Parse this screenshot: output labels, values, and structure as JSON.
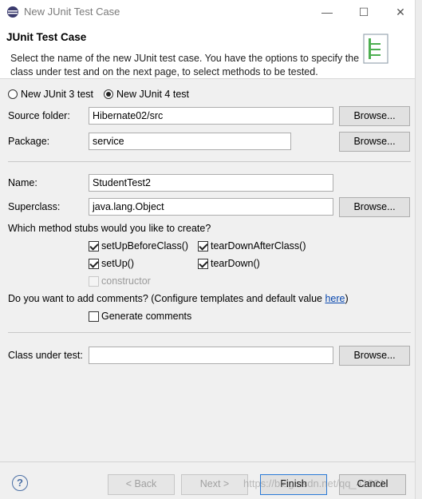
{
  "window": {
    "title": "New JUnit Test Case",
    "minimize_glyph": "—",
    "maximize_glyph": "☐",
    "close_glyph": "✕"
  },
  "banner": {
    "title": "JUnit Test Case",
    "description": "Select the name of the new JUnit test case. You have the options to specify the class under test and on the next page, to select methods to be tested."
  },
  "version": {
    "junit3_label": "New JUnit 3 test",
    "junit4_label": "New JUnit 4 test",
    "selected": "junit4"
  },
  "source_folder": {
    "label": "Source folder:",
    "value": "Hibernate02/src",
    "browse": "Browse..."
  },
  "package": {
    "label": "Package:",
    "value": "service",
    "browse": "Browse..."
  },
  "name": {
    "label": "Name:",
    "value": "StudentTest2"
  },
  "superclass": {
    "label": "Superclass:",
    "value": "java.lang.Object",
    "browse": "Browse..."
  },
  "stubs": {
    "question": "Which method stubs would you like to create?",
    "items": [
      {
        "label": "setUpBeforeClass()",
        "checked": true,
        "enabled": true
      },
      {
        "label": "tearDownAfterClass()",
        "checked": true,
        "enabled": true
      },
      {
        "label": "setUp()",
        "checked": true,
        "enabled": true
      },
      {
        "label": "tearDown()",
        "checked": true,
        "enabled": true
      },
      {
        "label": "constructor",
        "checked": false,
        "enabled": false
      }
    ]
  },
  "comments": {
    "question": "Do you want to add comments? (Configure templates and default value ",
    "link": "here",
    "closing": ")",
    "generate_label": "Generate comments",
    "generate_checked": false
  },
  "class_under_test": {
    "label": "Class under test:",
    "value": "",
    "browse": "Browse..."
  },
  "footer": {
    "help_glyph": "?",
    "back": "< Back",
    "next": "Next >",
    "finish": "Finish",
    "cancel": "Cancel"
  },
  "watermark": "https://blog.csdn.net/qq_41821"
}
